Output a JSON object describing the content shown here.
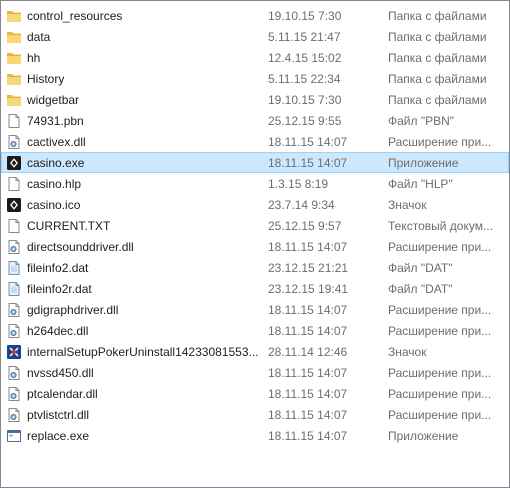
{
  "files": [
    {
      "name": "control_resources",
      "date": "19.10.15 7:30",
      "type": "Папка с файлами",
      "icon": "folder-icon"
    },
    {
      "name": "data",
      "date": "5.11.15 21:47",
      "type": "Папка с файлами",
      "icon": "folder-icon"
    },
    {
      "name": "hh",
      "date": "12.4.15 15:02",
      "type": "Папка с файлами",
      "icon": "folder-icon"
    },
    {
      "name": "History",
      "date": "5.11.15 22:34",
      "type": "Папка с файлами",
      "icon": "folder-icon"
    },
    {
      "name": "widgetbar",
      "date": "19.10.15 7:30",
      "type": "Папка с файлами",
      "icon": "folder-icon"
    },
    {
      "name": "74931.pbn",
      "date": "25.12.15 9:55",
      "type": "Файл \"PBN\"",
      "icon": "blank-file-icon"
    },
    {
      "name": "cactivex.dll",
      "date": "18.11.15 14:07",
      "type": "Расширение при...",
      "icon": "dll-icon"
    },
    {
      "name": "casino.exe",
      "date": "18.11.15 14:07",
      "type": "Приложение",
      "icon": "casino-app-icon",
      "selected": true
    },
    {
      "name": "casino.hlp",
      "date": "1.3.15 8:19",
      "type": "Файл \"HLP\"",
      "icon": "blank-file-icon"
    },
    {
      "name": "casino.ico",
      "date": "23.7.14 9:34",
      "type": "Значок",
      "icon": "casino-app-icon"
    },
    {
      "name": "CURRENT.TXT",
      "date": "25.12.15 9:57",
      "type": "Текстовый докум...",
      "icon": "blank-file-icon"
    },
    {
      "name": "directsounddriver.dll",
      "date": "18.11.15 14:07",
      "type": "Расширение при...",
      "icon": "dll-icon"
    },
    {
      "name": "fileinfo2.dat",
      "date": "23.12.15 21:21",
      "type": "Файл \"DAT\"",
      "icon": "dat-file-icon"
    },
    {
      "name": "fileinfo2r.dat",
      "date": "23.12.15 19:41",
      "type": "Файл \"DAT\"",
      "icon": "dat-file-icon"
    },
    {
      "name": "gdigraphdriver.dll",
      "date": "18.11.15 14:07",
      "type": "Расширение при...",
      "icon": "dll-icon"
    },
    {
      "name": "h264dec.dll",
      "date": "18.11.15 14:07",
      "type": "Расширение при...",
      "icon": "dll-icon"
    },
    {
      "name": "internalSetupPokerUninstall14233081553...",
      "date": "28.11.14 12:46",
      "type": "Значок",
      "icon": "poker-icon"
    },
    {
      "name": "nvssd450.dll",
      "date": "18.11.15 14:07",
      "type": "Расширение при...",
      "icon": "dll-icon"
    },
    {
      "name": "ptcalendar.dll",
      "date": "18.11.15 14:07",
      "type": "Расширение при...",
      "icon": "dll-icon"
    },
    {
      "name": "ptvlistctrl.dll",
      "date": "18.11.15 14:07",
      "type": "Расширение при...",
      "icon": "dll-icon"
    },
    {
      "name": "replace.exe",
      "date": "18.11.15 14:07",
      "type": "Приложение",
      "icon": "exe-window-icon"
    }
  ]
}
